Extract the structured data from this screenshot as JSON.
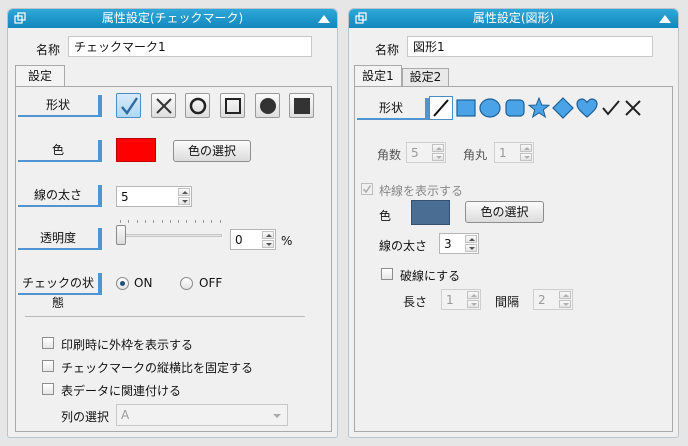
{
  "left_panel": {
    "title": "属性設定(チェックマーク)",
    "name_label": "名称",
    "name_value": "チェックマーク1",
    "tab": "設定",
    "shape_label": "形状",
    "shape_buttons": [
      "check-icon",
      "cross-icon",
      "circle-icon",
      "square-icon",
      "filled-circle-icon",
      "filled-square-icon"
    ],
    "color_label": "色",
    "color_value": "#ff0000",
    "color_button": "色の選択",
    "line_width_label": "線の太さ",
    "line_width_value": "5",
    "transparency_label": "透明度",
    "transparency_value": "0",
    "transparency_percent": 0,
    "percent_unit": "%",
    "check_state_label": "チェックの状態",
    "radio_on": "ON",
    "radio_off": "OFF",
    "option_print_frame": "印刷時に外枠を表示する",
    "option_fix_ratio": "チェックマークの縦横比を固定する",
    "option_link_table": "表データに関連付ける",
    "column_select_label": "列の選択",
    "column_select_value": "A"
  },
  "right_panel": {
    "title": "属性設定(図形)",
    "name_label": "名称",
    "name_value": "図形1",
    "tab1": "設定1",
    "tab2": "設定2",
    "shape_label": "形状",
    "shape_icons": [
      "line-icon",
      "rectangle-icon",
      "ellipse-icon",
      "rounded-rect-icon",
      "star-icon",
      "diamond-icon",
      "heart-icon",
      "check-icon",
      "cross-icon"
    ],
    "corners_label": "角数",
    "corners_value": "5",
    "round_label": "角丸",
    "round_value": "1",
    "show_border_label": "枠線を表示する",
    "color_label": "色",
    "color_value": "#4a6d94",
    "color_button": "色の選択",
    "line_width_label": "線の太さ",
    "line_width_value": "3",
    "dashed_label": "破線にする",
    "length_label": "長さ",
    "length_value": "1",
    "spacing_label": "間隔",
    "spacing_value": "2"
  },
  "colors": {
    "title_bar": "#1a93c9",
    "accent": "#4d96d2"
  }
}
